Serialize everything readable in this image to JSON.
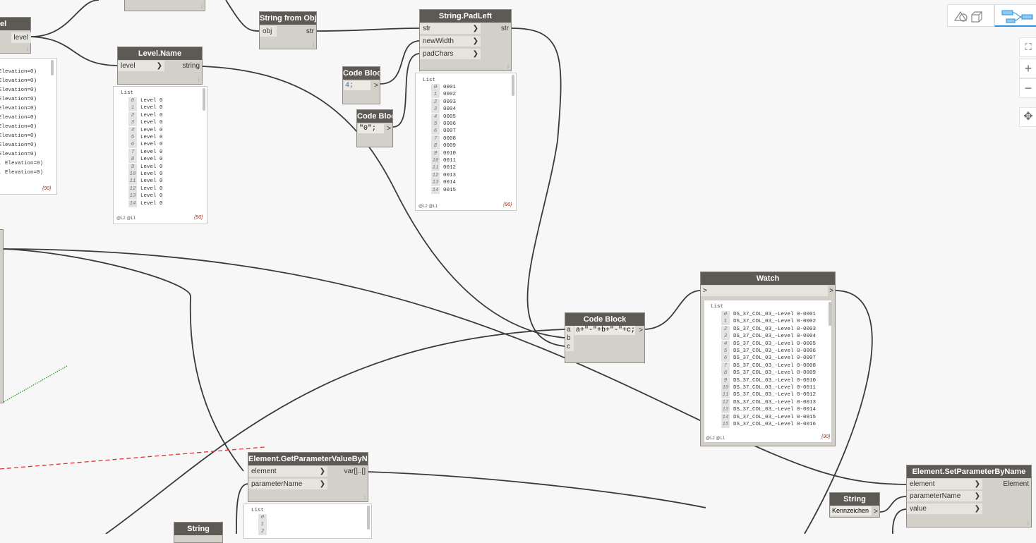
{
  "nodes": {
    "level_partial": {
      "title": "el",
      "out": "level"
    },
    "string_from_object": {
      "title": "String from Object",
      "in": "obj",
      "out": "str"
    },
    "string_padleft": {
      "title": "String.PadLeft",
      "in": [
        "str",
        "newWidth",
        "padChars"
      ],
      "out": "str"
    },
    "level_name": {
      "title": "Level.Name",
      "in": "level",
      "out": "string"
    },
    "code_block_4": {
      "title": "Code Block",
      "code": "4;",
      "out": ">"
    },
    "code_block_0": {
      "title": "Code Block",
      "code": "\"0\";",
      "out": ">"
    },
    "code_block_concat": {
      "title": "Code Block",
      "code": "a+\"-\"+b+\"-\"+c;",
      "in": [
        "a",
        "b",
        "c"
      ],
      "out": ">"
    },
    "watch": {
      "title": "Watch",
      "in": ">",
      "out": ">"
    },
    "get_param": {
      "title": "Element.GetParameterValueByName",
      "in": [
        "element",
        "parameterName"
      ],
      "out": "var[]..[]"
    },
    "set_param": {
      "title": "Element.SetParameterByName",
      "in": [
        "element",
        "parameterName",
        "value"
      ],
      "out": "Element"
    },
    "string_kz": {
      "title": "String",
      "value": "Kennzeichen",
      "out": ">"
    },
    "string_bottom": {
      "title": "String"
    }
  },
  "previews": {
    "left_partial": {
      "rows": [
        "Elevation=0)",
        "Elevation=0)",
        "Elevation=0)",
        "Elevation=0)",
        "Elevation=0)",
        "Elevation=0)",
        "Elevation=0)",
        "Elevation=0)",
        "Elevation=0)",
        "Elevation=0)",
        ", Elevation=0)",
        ", Elevation=0)"
      ],
      "count": "{90}"
    },
    "level_name": {
      "list": "List",
      "rows": [
        [
          "0",
          "Level 0"
        ],
        [
          "1",
          "Level 0"
        ],
        [
          "2",
          "Level 0"
        ],
        [
          "3",
          "Level 0"
        ],
        [
          "4",
          "Level 0"
        ],
        [
          "5",
          "Level 0"
        ],
        [
          "6",
          "Level 0"
        ],
        [
          "7",
          "Level 0"
        ],
        [
          "8",
          "Level 0"
        ],
        [
          "9",
          "Level 0"
        ],
        [
          "10",
          "Level 0"
        ],
        [
          "11",
          "Level 0"
        ],
        [
          "12",
          "Level 0"
        ],
        [
          "13",
          "Level 0"
        ],
        [
          "14",
          "Level 0"
        ]
      ],
      "levels": "@L2 @L1",
      "count": "{90}"
    },
    "padleft": {
      "list": "List",
      "rows": [
        [
          "0",
          "0001"
        ],
        [
          "1",
          "0002"
        ],
        [
          "2",
          "0003"
        ],
        [
          "3",
          "0004"
        ],
        [
          "4",
          "0005"
        ],
        [
          "5",
          "0006"
        ],
        [
          "6",
          "0007"
        ],
        [
          "7",
          "0008"
        ],
        [
          "8",
          "0009"
        ],
        [
          "9",
          "0010"
        ],
        [
          "10",
          "0011"
        ],
        [
          "11",
          "0012"
        ],
        [
          "12",
          "0013"
        ],
        [
          "13",
          "0014"
        ],
        [
          "14",
          "0015"
        ]
      ],
      "levels": "@L2 @L1",
      "count": "{90}"
    },
    "watch": {
      "list": "List",
      "rows": [
        [
          "0",
          "DS_37_COL_03_-Level 0-0001"
        ],
        [
          "1",
          "DS_37_COL_03_-Level 0-0002"
        ],
        [
          "2",
          "DS_37_COL_03_-Level 0-0003"
        ],
        [
          "3",
          "DS_37_COL_03_-Level 0-0004"
        ],
        [
          "4",
          "DS_37_COL_03_-Level 0-0005"
        ],
        [
          "5",
          "DS_37_COL_03_-Level 0-0006"
        ],
        [
          "6",
          "DS_37_COL_03_-Level 0-0007"
        ],
        [
          "7",
          "DS_37_COL_03_-Level 0-0008"
        ],
        [
          "8",
          "DS_37_COL_03_-Level 0-0009"
        ],
        [
          "9",
          "DS_37_COL_03_-Level 0-0010"
        ],
        [
          "10",
          "DS_37_COL_03_-Level 0-0011"
        ],
        [
          "11",
          "DS_37_COL_03_-Level 0-0012"
        ],
        [
          "12",
          "DS_37_COL_03_-Level 0-0013"
        ],
        [
          "13",
          "DS_37_COL_03_-Level 0-0014"
        ],
        [
          "14",
          "DS_37_COL_03_-Level 0-0015"
        ],
        [
          "15",
          "DS_37_COL_03_-Level 0-0016"
        ]
      ],
      "levels": "@L2 @L1",
      "count": "{90}"
    },
    "get_param": {
      "list": "List",
      "rows": [
        "0",
        "1",
        "2"
      ]
    }
  },
  "canvas_controls": [
    "fit-to-view-icon",
    "zoom-in-icon",
    "zoom-out-icon",
    "pan-icon"
  ],
  "canvas_controls_glyphs": {
    "zoom_in": "+",
    "zoom_out": "−",
    "pan": "✥",
    "fit": "⛶"
  },
  "colors": {
    "node_header": "#5d5a56",
    "node_body": "#d3d0c9",
    "wire": "#3a3a3a",
    "dashed_red": "#e03030",
    "dotted_green": "#2a9a2a",
    "toggle_accent": "#2a90e0"
  }
}
